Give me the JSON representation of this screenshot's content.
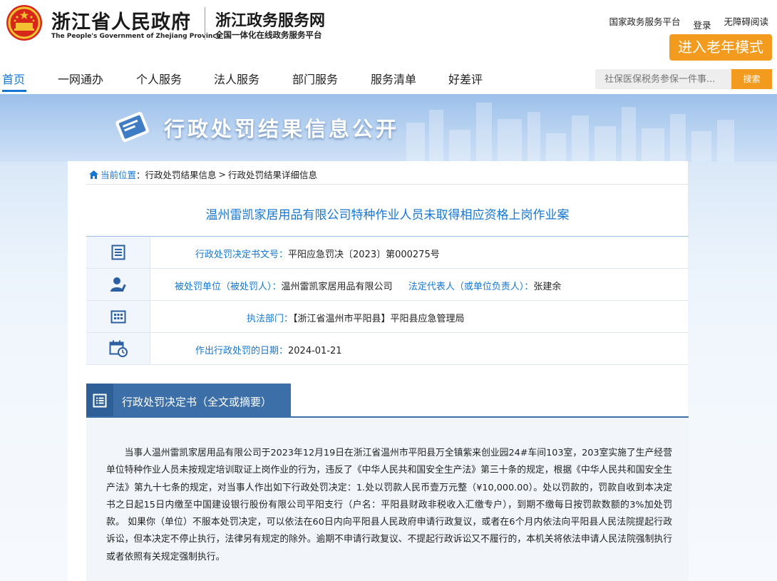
{
  "header": {
    "gov_title": "浙江省人民政府",
    "gov_title_en": "The People's Government of Zhejiang Province",
    "service_title": "浙江政务服务网",
    "service_subtitle": "全国一体化在线政务服务平台",
    "links": {
      "national_platform": "国家政务服务平台",
      "login": "登录",
      "accessibility": "无障碍阅读"
    },
    "elder_mode_label": "进入老年模式"
  },
  "nav": {
    "items": [
      "首页",
      "一网通办",
      "个人服务",
      "法人服务",
      "部门服务",
      "服务清单",
      "好差评"
    ],
    "active_index": 0,
    "search_placeholder": "社保医保税务参保一件事...",
    "search_button": "搜索"
  },
  "banner": {
    "title": "行政处罚结果信息公开"
  },
  "breadcrumb": {
    "prefix": "当前位置",
    "items": [
      "行政处罚结果信息",
      "行政处罚结果详细信息"
    ],
    "separator": ">"
  },
  "case": {
    "title": "温州雷凯家居用品有限公司特种作业人员未取得相应资格上岗作业案",
    "decision_no_label": "行政处罚决定书文号：",
    "decision_no": "平阳应急罚决〔2023〕第000275号",
    "party_label": "被处罚单位（被处罚人）：",
    "party": "温州雷凯家居用品有限公司",
    "legal_rep_label": "法定代表人（或单位负责人）：",
    "legal_rep": "张建余",
    "agency_label": "执法部门：",
    "agency": "【浙江省温州市平阳县】平阳县应急管理局",
    "date_label": "作出行政处罚的日期：",
    "date": "2024-01-21"
  },
  "decision_section": {
    "title": "行政处罚决定书（全文或摘要）",
    "text": "当事人温州雷凯家居用品有限公司于2023年12月19日在浙江省温州市平阳县万全镇紫来创业园24#车间103室，203室实施了生产经营单位特种作业人员未按规定培训取证上岗作业的行为，违反了《中华人民共和国安全生产法》第三十条的规定，根据《中华人民共和国安全生产法》第九十七条的规定，对当事人作出如下行政处罚决定：1.处以罚款人民币壹万元整（¥10,000.00）。处以罚款的，罚款自收到本决定书之日起15日内缴至中国建设银行股份有限公司平阳支行（户名：平阳县财政非税收入汇缴专户），到期不缴每日按罚款数额的3%加处罚款。 如果你（单位）不服本处罚决定，可以依法在60日内向平阳县人民政府申请行政复议，或者在6个月内依法向平阳县人民法院提起行政诉讼，但本决定不停止执行，法律另有规定的除外。逾期不申请行政复议、不提起行政诉讼又不履行的，本机关将依法申请人民法院强制执行或者依照有关规定强制执行。"
  },
  "colors": {
    "primary_blue": "#1677d2",
    "accent_orange": "#f39b1f",
    "section_blue": "#3c6fa8"
  },
  "icons": [
    "national-emblem-icon",
    "book-icon",
    "home-icon",
    "document-icon",
    "person-icon",
    "building-icon",
    "calendar-icon",
    "list-icon"
  ]
}
